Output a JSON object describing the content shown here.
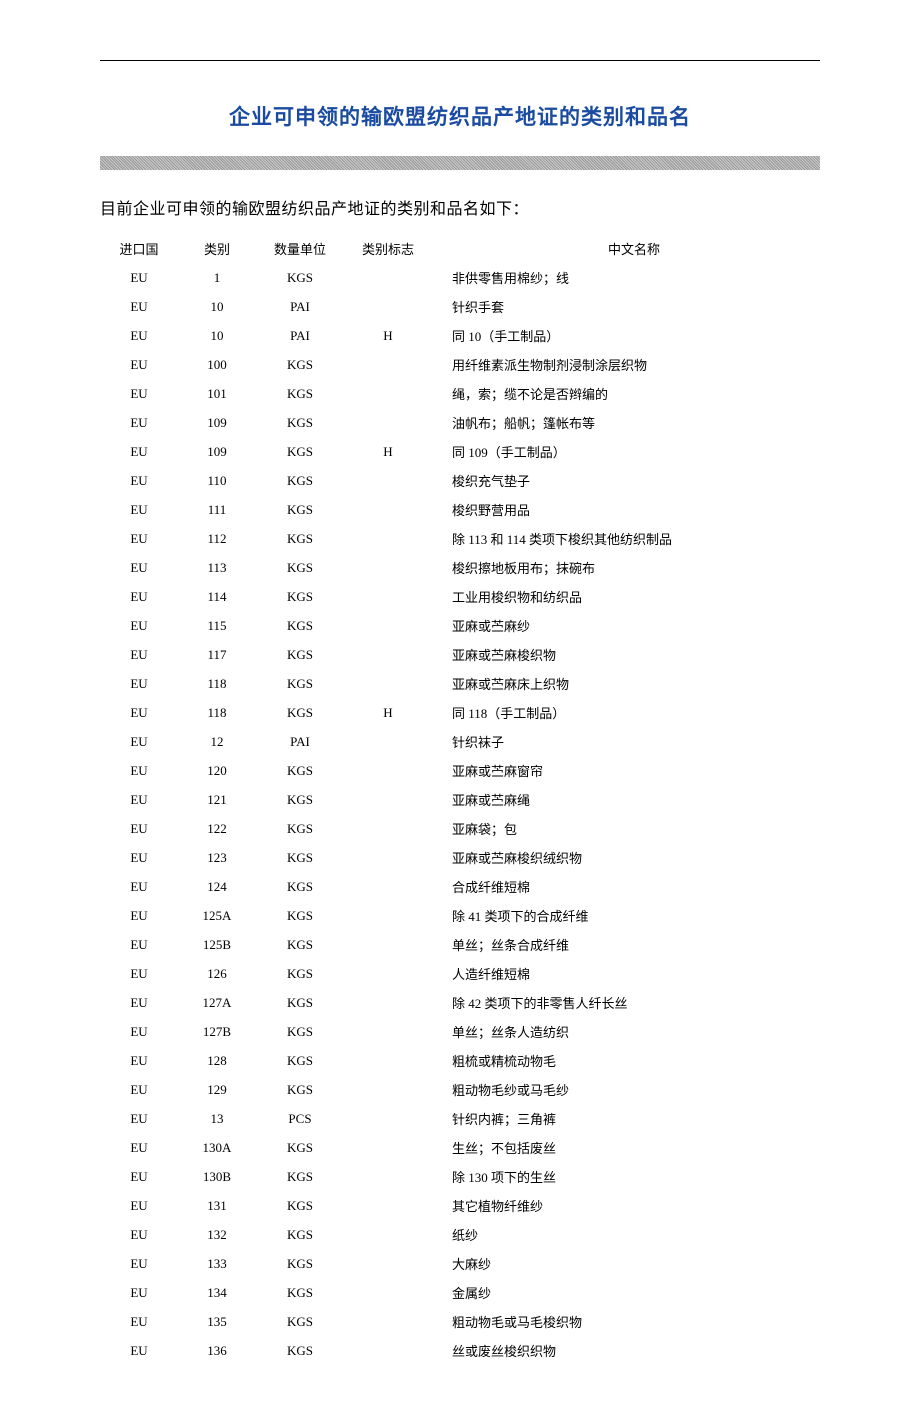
{
  "title": "企业可申领的输欧盟纺织品产地证的类别和品名",
  "intro": "目前企业可申领的输欧盟纺织品产地证的类别和品名如下：",
  "headers": {
    "country": "进口国",
    "category": "类别",
    "unit": "数量单位",
    "flag": "类别标志",
    "name": "中文名称"
  },
  "rows": [
    {
      "country": "EU",
      "category": "1",
      "unit": "KGS",
      "flag": "",
      "name": "非供零售用棉纱；线"
    },
    {
      "country": "EU",
      "category": "10",
      "unit": "PAI",
      "flag": "",
      "name": "针织手套"
    },
    {
      "country": "EU",
      "category": "10",
      "unit": "PAI",
      "flag": "H",
      "name": "同 10（手工制品）"
    },
    {
      "country": "EU",
      "category": "100",
      "unit": "KGS",
      "flag": "",
      "name": "用纤维素派生物制剂浸制涂层织物"
    },
    {
      "country": "EU",
      "category": "101",
      "unit": "KGS",
      "flag": "",
      "name": "绳，索；缆不论是否辫编的"
    },
    {
      "country": "EU",
      "category": "109",
      "unit": "KGS",
      "flag": "",
      "name": "油帆布；船帆；篷帐布等"
    },
    {
      "country": "EU",
      "category": "109",
      "unit": "KGS",
      "flag": "H",
      "name": "同 109（手工制品）"
    },
    {
      "country": "EU",
      "category": "110",
      "unit": "KGS",
      "flag": "",
      "name": "梭织充气垫子"
    },
    {
      "country": "EU",
      "category": "111",
      "unit": "KGS",
      "flag": "",
      "name": "梭织野营用品"
    },
    {
      "country": "EU",
      "category": "112",
      "unit": "KGS",
      "flag": "",
      "name": "除 113 和 114 类项下梭织其他纺织制品"
    },
    {
      "country": "EU",
      "category": "113",
      "unit": "KGS",
      "flag": "",
      "name": "梭织擦地板用布；抹碗布"
    },
    {
      "country": "EU",
      "category": "114",
      "unit": "KGS",
      "flag": "",
      "name": "工业用梭织物和纺织品"
    },
    {
      "country": "EU",
      "category": "115",
      "unit": "KGS",
      "flag": "",
      "name": "亚麻或苎麻纱"
    },
    {
      "country": "EU",
      "category": "117",
      "unit": "KGS",
      "flag": "",
      "name": "亚麻或苎麻梭织物"
    },
    {
      "country": "EU",
      "category": "118",
      "unit": "KGS",
      "flag": "",
      "name": "亚麻或苎麻床上织物"
    },
    {
      "country": "EU",
      "category": "118",
      "unit": "KGS",
      "flag": "H",
      "name": "同 118（手工制品）"
    },
    {
      "country": "EU",
      "category": "12",
      "unit": "PAI",
      "flag": "",
      "name": "针织袜子"
    },
    {
      "country": "EU",
      "category": "120",
      "unit": "KGS",
      "flag": "",
      "name": "亚麻或苎麻窗帘"
    },
    {
      "country": "EU",
      "category": "121",
      "unit": "KGS",
      "flag": "",
      "name": "亚麻或苎麻绳"
    },
    {
      "country": "EU",
      "category": "122",
      "unit": "KGS",
      "flag": "",
      "name": "亚麻袋；包"
    },
    {
      "country": "EU",
      "category": "123",
      "unit": "KGS",
      "flag": "",
      "name": "亚麻或苎麻梭织绒织物"
    },
    {
      "country": "EU",
      "category": "124",
      "unit": "KGS",
      "flag": "",
      "name": "合成纤维短棉"
    },
    {
      "country": "EU",
      "category": "125A",
      "unit": "KGS",
      "flag": "",
      "name": "除 41 类项下的合成纤维"
    },
    {
      "country": "EU",
      "category": "125B",
      "unit": "KGS",
      "flag": "",
      "name": "单丝；丝条合成纤维"
    },
    {
      "country": "EU",
      "category": "126",
      "unit": "KGS",
      "flag": "",
      "name": "人造纤维短棉"
    },
    {
      "country": "EU",
      "category": "127A",
      "unit": "KGS",
      "flag": "",
      "name": "除 42 类项下的非零售人纤长丝"
    },
    {
      "country": "EU",
      "category": "127B",
      "unit": "KGS",
      "flag": "",
      "name": "单丝；丝条人造纺织"
    },
    {
      "country": "EU",
      "category": "128",
      "unit": "KGS",
      "flag": "",
      "name": "粗梳或精梳动物毛"
    },
    {
      "country": "EU",
      "category": "129",
      "unit": "KGS",
      "flag": "",
      "name": "粗动物毛纱或马毛纱"
    },
    {
      "country": "EU",
      "category": "13",
      "unit": "PCS",
      "flag": "",
      "name": "针织内裤；三角裤"
    },
    {
      "country": "EU",
      "category": "130A",
      "unit": "KGS",
      "flag": "",
      "name": "生丝；不包括废丝"
    },
    {
      "country": "EU",
      "category": "130B",
      "unit": "KGS",
      "flag": "",
      "name": "除 130 项下的生丝"
    },
    {
      "country": "EU",
      "category": "131",
      "unit": "KGS",
      "flag": "",
      "name": "其它植物纤维纱"
    },
    {
      "country": "EU",
      "category": "132",
      "unit": "KGS",
      "flag": "",
      "name": "纸纱"
    },
    {
      "country": "EU",
      "category": "133",
      "unit": "KGS",
      "flag": "",
      "name": "大麻纱"
    },
    {
      "country": "EU",
      "category": "134",
      "unit": "KGS",
      "flag": "",
      "name": "金属纱"
    },
    {
      "country": "EU",
      "category": "135",
      "unit": "KGS",
      "flag": "",
      "name": "粗动物毛或马毛梭织物"
    },
    {
      "country": "EU",
      "category": "136",
      "unit": "KGS",
      "flag": "",
      "name": "丝或废丝梭织织物"
    }
  ]
}
